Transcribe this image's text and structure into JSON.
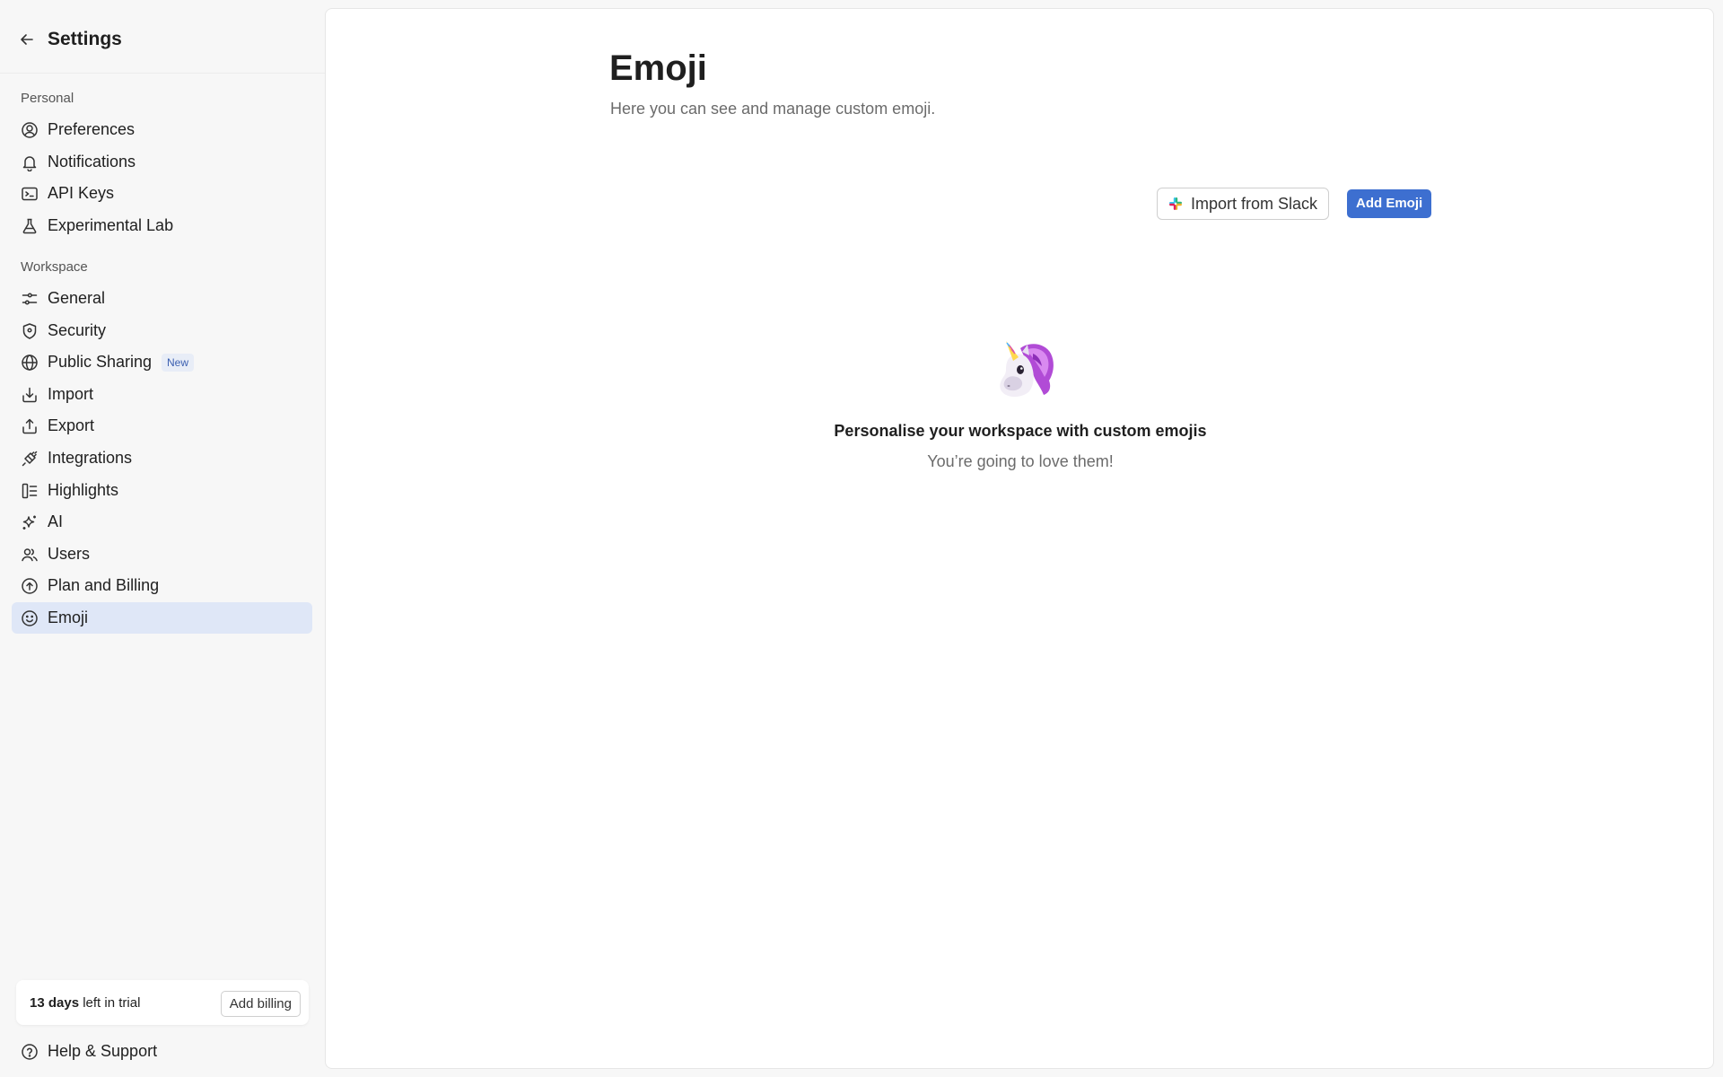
{
  "sidebar": {
    "title": "Settings",
    "personal_label": "Personal",
    "personal_items": [
      {
        "label": "Preferences",
        "icon": "user-circle-icon"
      },
      {
        "label": "Notifications",
        "icon": "bell-icon"
      },
      {
        "label": "API Keys",
        "icon": "terminal-icon"
      },
      {
        "label": "Experimental Lab",
        "icon": "flask-icon"
      }
    ],
    "workspace_label": "Workspace",
    "workspace_items": [
      {
        "label": "General",
        "icon": "sliders-icon"
      },
      {
        "label": "Security",
        "icon": "shield-icon"
      },
      {
        "label": "Public Sharing",
        "icon": "globe-icon",
        "badge": "New"
      },
      {
        "label": "Import",
        "icon": "import-icon"
      },
      {
        "label": "Export",
        "icon": "export-icon"
      },
      {
        "label": "Integrations",
        "icon": "plug-icon"
      },
      {
        "label": "Highlights",
        "icon": "highlights-icon"
      },
      {
        "label": "AI",
        "icon": "sparkles-icon"
      },
      {
        "label": "Users",
        "icon": "users-icon"
      },
      {
        "label": "Plan and Billing",
        "icon": "billing-icon"
      },
      {
        "label": "Emoji",
        "icon": "smile-icon",
        "active": true
      }
    ],
    "trial": {
      "days": "13 days",
      "suffix": " left in trial",
      "button": "Add billing"
    },
    "help": "Help & Support"
  },
  "main": {
    "title": "Emoji",
    "subtitle": "Here you can see and manage custom emoji.",
    "import_button": "Import from Slack",
    "add_button": "Add Emoji",
    "empty": {
      "emoji": "unicorn",
      "title": "Personalise your workspace with custom emojis",
      "subtitle": "You’re going to love them!"
    }
  },
  "colors": {
    "accent": "#3d6fd0",
    "active_bg": "#dfe7f7",
    "sidebar_bg": "#f7f7f7"
  }
}
